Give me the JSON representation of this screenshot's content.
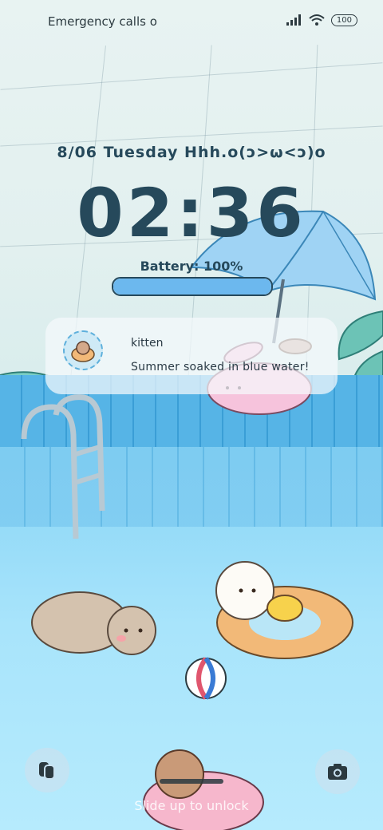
{
  "status_bar": {
    "carrier_text": "Emergency calls o",
    "battery_level": "100",
    "icons": [
      "signal-icon",
      "wifi-icon",
      "battery-icon"
    ]
  },
  "lockscreen": {
    "date_line": "8/06  Tuesday   Hhh.o(ɔ>ω<ɔ)o",
    "clock": "02:36",
    "battery_label": "Battery:   100%",
    "battery_fraction": 1.0
  },
  "notification": {
    "title": "kitten",
    "body": "Summer soaked in blue water!"
  },
  "bottom": {
    "hint": "Slide up to unlock",
    "left_button_icon": "widgets-icon",
    "right_button_icon": "camera-icon"
  },
  "colors": {
    "accent": "#26495b",
    "battery_fill": "#6cb8ee"
  }
}
